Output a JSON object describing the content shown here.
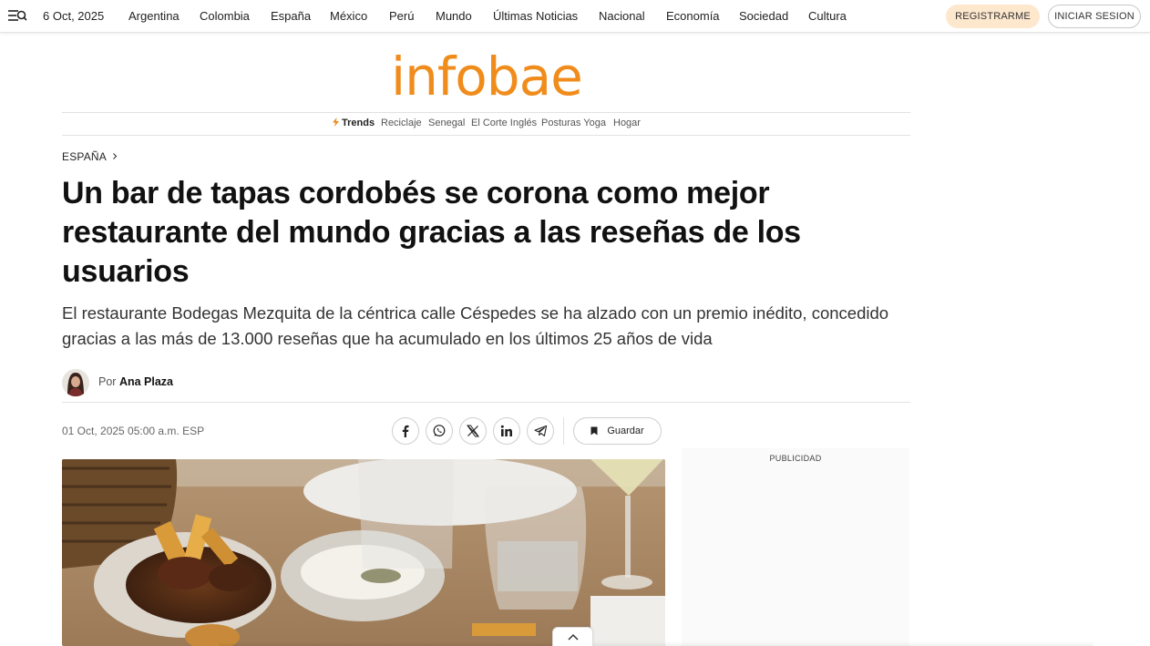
{
  "topbar": {
    "date": "6 Oct, 2025",
    "nav": [
      "Argentina",
      "Colombia",
      "España",
      "México",
      "Perú",
      "Mundo",
      "Últimas Noticias",
      "Nacional",
      "Economía",
      "Sociedad",
      "Cultura"
    ],
    "register_label": "REGISTRARME",
    "login_label": "INICIAR SESION"
  },
  "logo": {
    "text": "infobae",
    "color": "#f08c1c"
  },
  "trends": {
    "label": "Trends",
    "items": [
      "Reciclaje",
      "Senegal",
      "El Corte Inglés",
      "Posturas Yoga",
      "Hogar"
    ]
  },
  "article": {
    "section": "ESPAÑA",
    "headline": "Un bar de tapas cordobés se corona como mejor restaurante del mundo gracias a las reseñas de los usuarios",
    "subheadline": "El restaurante Bodegas Mezquita de la céntrica calle Céspedes se ha alzado con un premio inédito, concedido gracias a las más de 13.000 reseñas que ha acumulado en los últimos 25 años de vida",
    "byline_prefix": "Por",
    "author": "Ana Plaza",
    "published": "01 Oct, 2025 05:00 a.m. ESP",
    "save_label": "Guardar"
  },
  "share_icons": [
    "facebook-icon",
    "whatsapp-icon",
    "x-icon",
    "linkedin-icon",
    "telegram-icon"
  ],
  "ad": {
    "label": "PUBLICIDAD"
  }
}
